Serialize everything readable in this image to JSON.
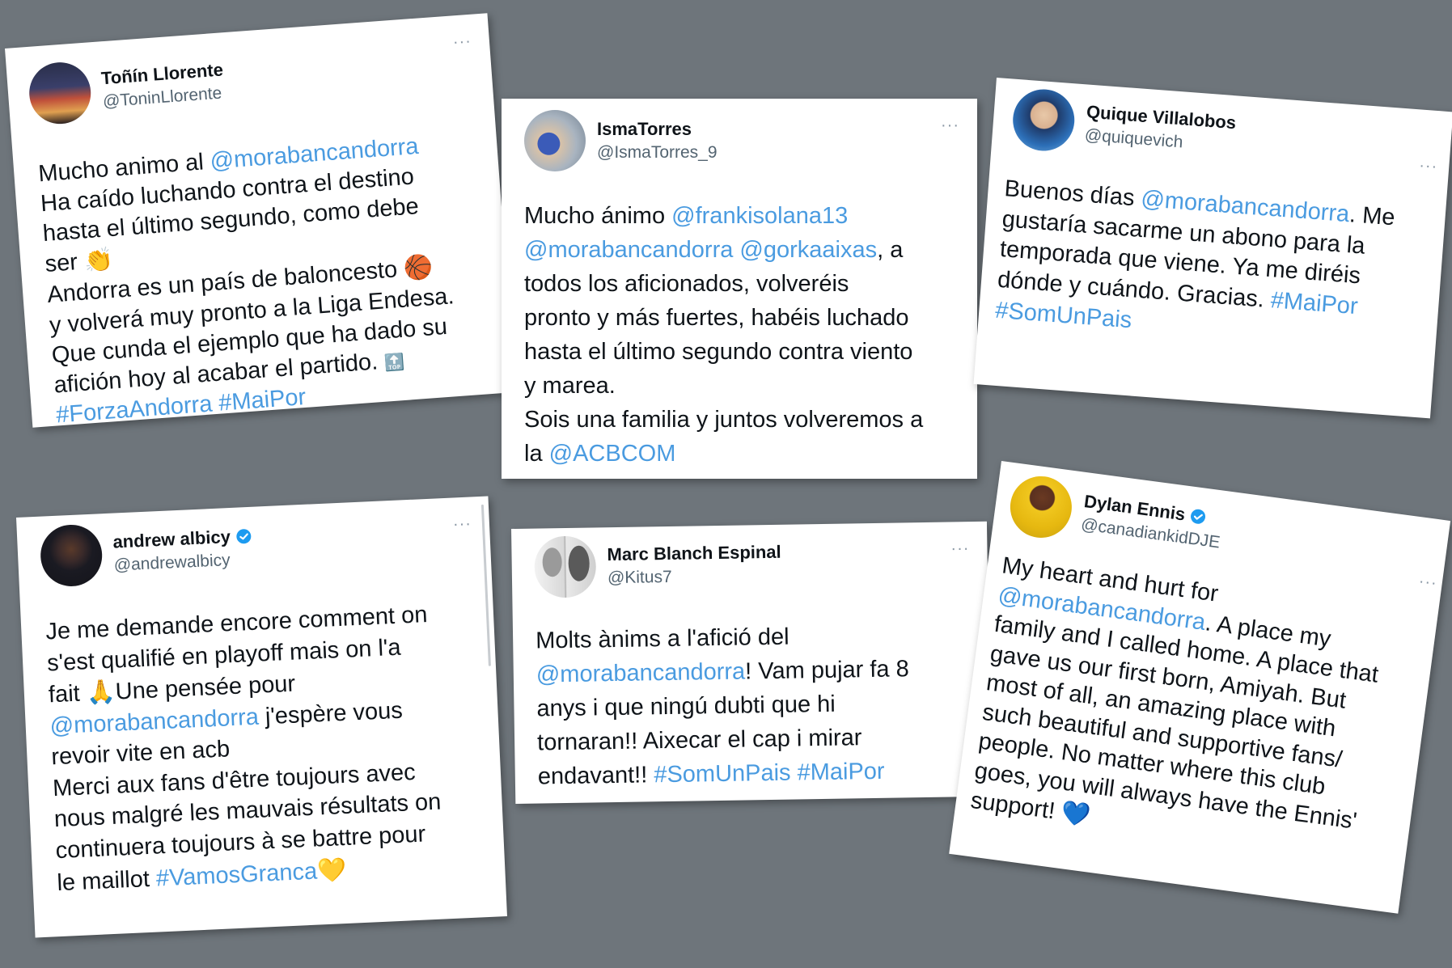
{
  "colors": {
    "background": "#6e757b",
    "link": "#4a9be0",
    "verified": "#1d9bf0"
  },
  "tweets": [
    {
      "name": "Toñín Llorente",
      "handle": "@ToninLlorente",
      "more": "···",
      "p": [
        "Mucho animo al ",
        "@morabancandorra",
        "Ha caído luchando contra el destino",
        "hasta el último segundo, como debe",
        "ser ",
        "👏",
        "Andorra es un país de baloncesto ",
        "🏀",
        "y volverá muy pronto a la Liga Endesa.",
        "Que cunda el ejemplo que ha dado su",
        "afición hoy al acabar el partido. ",
        "🔝",
        "#ForzaAndorra",
        "#MaiPor"
      ]
    },
    {
      "name": "IsmaTorres",
      "handle": "@IsmaTorres_9",
      "more": "···",
      "p": [
        "Mucho ánimo ",
        "@frankisolana13",
        "@morabancandorra",
        "@gorkaaixas",
        ", a",
        "todos los aficionados, volveréis",
        "pronto y más fuertes, habéis luchado",
        "hasta el último segundo  contra viento",
        "y marea.",
        "Sois una familia y juntos volveremos a",
        "la ",
        "@ACBCOM"
      ]
    },
    {
      "name": "Quique Villalobos",
      "handle": "@quiquevich",
      "more": "···",
      "p": [
        "Buenos días ",
        "@morabancandorra",
        ". Me",
        "gustaría sacarme un abono para la",
        "temporada que viene. Ya me diréis",
        "dónde y cuándo. Gracias. ",
        "#MaiPor",
        "#SomUnPais"
      ]
    },
    {
      "name": "andrew albicy",
      "handle": "@andrewalbicy",
      "more": "···",
      "p": [
        "Je me demande encore comment on",
        "s'est qualifié en playoff mais on l'a",
        "fait ",
        "🙏",
        "Une pensée pour",
        "@morabancandorra",
        "  j'espère vous",
        "revoir vite en acb",
        "Merci aux fans d'être toujours avec",
        "nous malgré les mauvais résultats on",
        "continuera toujours à se battre pour",
        "le maillot ",
        "#VamosGranca",
        "💛"
      ]
    },
    {
      "name": "Marc Blanch Espinal",
      "handle": "@Kitus7",
      "more": "···",
      "p": [
        "Molts ànims a l'afició del",
        "@morabancandorra",
        "! Vam pujar fa 8",
        "anys i que ningú dubti que hi",
        "tornaran!! Aixecar el cap i mirar",
        "endavant!! ",
        "#SomUnPais",
        "#MaiPor"
      ]
    },
    {
      "name": "Dylan Ennis",
      "handle": "@canadiankidDJE",
      "more": "···",
      "p": [
        "My heart and hurt for",
        "@morabancandorra",
        ". A place my",
        "family and I called home. A place that",
        "gave us our first born, Amiyah. But",
        "most of all, an amazing place with",
        "such beautiful and supportive fans/",
        "people. No matter where this club",
        "goes, you will always have the Ennis'",
        "support! ",
        "💙"
      ]
    }
  ]
}
